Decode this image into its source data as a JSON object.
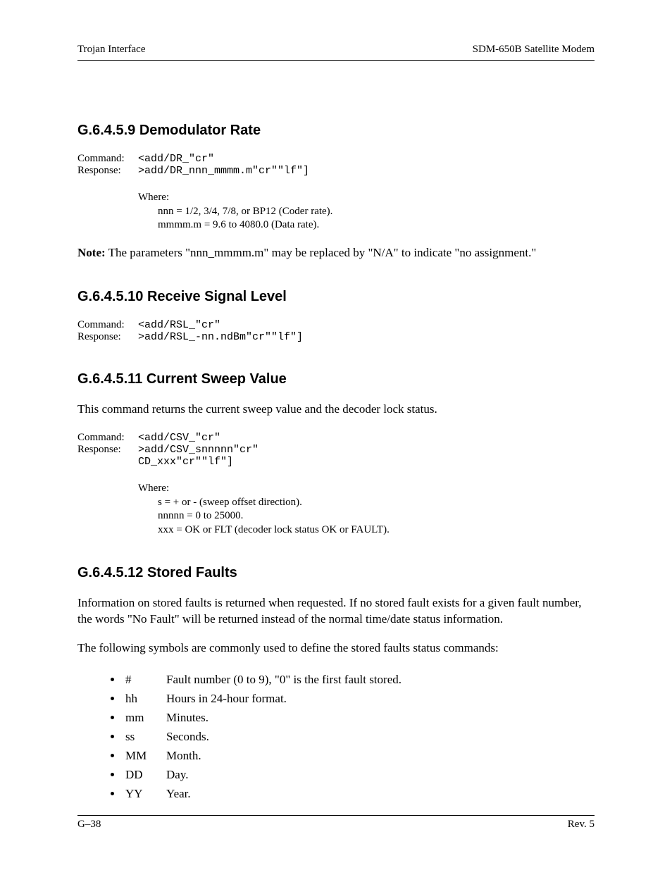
{
  "header": {
    "left": "Trojan Interface",
    "right": "SDM-650B Satellite Modem"
  },
  "sections": {
    "s9": {
      "heading": "G.6.4.5.9  Demodulator Rate",
      "cmd_label": "Command:",
      "cmd_code": "<add/DR_\"cr\"",
      "resp_label": "Response:",
      "resp_code": ">add/DR_nnn_mmmm.m\"cr\"\"lf\"]",
      "where_label": "Where:",
      "where_1": "nnn = 1/2, 3/4, 7/8, or BP12 (Coder rate).",
      "where_2": "mmmm.m = 9.6 to 4080.0 (Data rate).",
      "note_label": "Note:",
      "note_text": " The parameters \"nnn_mmmm.m\" may be replaced by \"N/A\" to indicate \"no assignment.\""
    },
    "s10": {
      "heading": "G.6.4.5.10  Receive Signal Level",
      "cmd_label": "Command:",
      "cmd_code": "<add/RSL_\"cr\"",
      "resp_label": "Response:",
      "resp_code": ">add/RSL_-nn.ndBm\"cr\"\"lf\"]"
    },
    "s11": {
      "heading": "G.6.4.5.11  Current Sweep Value",
      "intro": "This command returns the current sweep value and the decoder lock status.",
      "cmd_label": "Command:",
      "cmd_code": "<add/CSV_\"cr\"",
      "resp_label": "Response:",
      "resp_code": ">add/CSV_snnnnn\"cr\"\nCD_xxx\"cr\"\"lf\"]",
      "where_label": "Where:",
      "where_1": "s = + or - (sweep offset direction).",
      "where_2": "nnnnn = 0 to 25000.",
      "where_3": "xxx = OK or FLT (decoder lock status OK or FAULT)."
    },
    "s12": {
      "heading": "G.6.4.5.12  Stored Faults",
      "para1": "Information on stored faults is returned when requested. If no stored fault exists for a given fault number, the words \"No Fault\" will be returned instead of the normal time/date status information.",
      "para2": "The following symbols are commonly used to define the stored faults status commands:",
      "items": [
        {
          "sym": "#",
          "desc": "Fault number (0 to 9), \"0\" is the first fault stored."
        },
        {
          "sym": "hh",
          "desc": "Hours in 24-hour format."
        },
        {
          "sym": "mm",
          "desc": "Minutes."
        },
        {
          "sym": "ss",
          "desc": "Seconds."
        },
        {
          "sym": "MM",
          "desc": "Month."
        },
        {
          "sym": "DD",
          "desc": "Day."
        },
        {
          "sym": "YY",
          "desc": "Year."
        }
      ]
    }
  },
  "footer": {
    "left": "G–38",
    "right": "Rev. 5"
  }
}
